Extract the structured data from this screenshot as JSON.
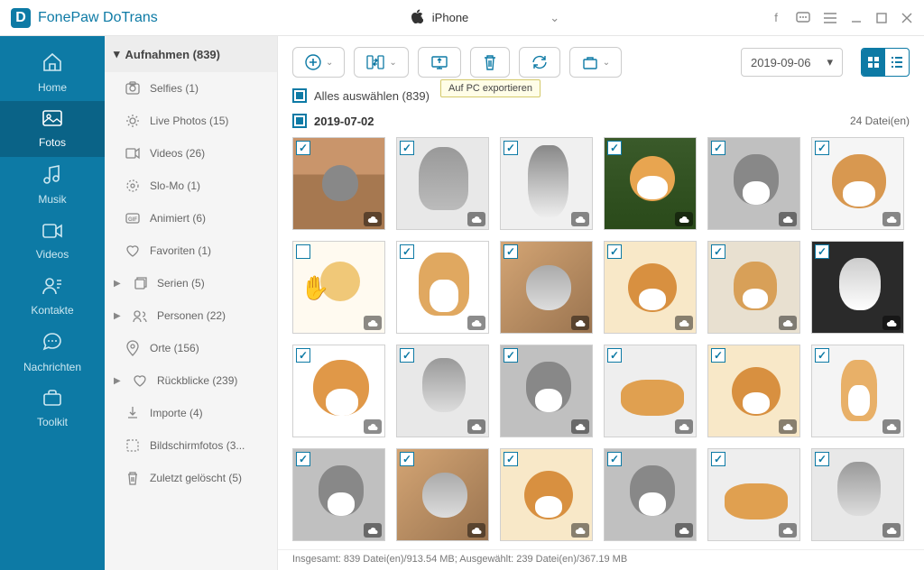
{
  "app_title": "FonePaw DoTrans",
  "device": "iPhone",
  "nav": [
    {
      "label": "Home"
    },
    {
      "label": "Fotos"
    },
    {
      "label": "Musik"
    },
    {
      "label": "Videos"
    },
    {
      "label": "Kontakte"
    },
    {
      "label": "Nachrichten"
    },
    {
      "label": "Toolkit"
    }
  ],
  "subnav": {
    "header": "Aufnahmen (839)",
    "items": [
      {
        "label": "Selfies (1)"
      },
      {
        "label": "Live Photos (15)"
      },
      {
        "label": "Videos (26)"
      },
      {
        "label": "Slo-Mo (1)"
      },
      {
        "label": "Animiert (6)"
      },
      {
        "label": "Favoriten (1)"
      },
      {
        "label": "Serien (5)",
        "arrow": true
      },
      {
        "label": "Personen (22)",
        "arrow": true
      },
      {
        "label": "Orte (156)"
      },
      {
        "label": "Rückblicke (239)",
        "arrow": true
      },
      {
        "label": "Importe (4)"
      },
      {
        "label": "Bildschirmfotos (3..."
      },
      {
        "label": "Zuletzt gelöscht (5)"
      }
    ]
  },
  "tooltip": "Auf PC exportieren",
  "date_picker": "2019-09-06",
  "select_all": "Alles auswählen (839)",
  "date_group": "2019-07-02",
  "file_count": "24 Datei(en)",
  "statusbar": "Insgesamt: 839 Datei(en)/913.54 MB; Ausgewählt: 239 Datei(en)/367.19 MB",
  "thumbs": {
    "row1": [
      {
        "img": "cat1",
        "checked": true
      },
      {
        "img": "cat2",
        "checked": true
      },
      {
        "img": "cat3",
        "checked": true
      },
      {
        "img": "dog1",
        "checked": true
      },
      {
        "img": "catgw",
        "checked": true
      },
      {
        "img": "dog2",
        "checked": true
      }
    ],
    "row2": [
      {
        "img": "hands",
        "checked": false
      },
      {
        "img": "dog3",
        "checked": true
      },
      {
        "img": "cat4",
        "checked": true
      },
      {
        "img": "dog4",
        "checked": true
      },
      {
        "img": "pup",
        "checked": true
      },
      {
        "img": "cat5",
        "checked": true
      }
    ],
    "row3": [
      {
        "img": "shiba",
        "checked": true
      },
      {
        "img": "catlook",
        "checked": true
      },
      {
        "img": "catgw",
        "checked": true
      },
      {
        "img": "shibalie",
        "checked": true
      },
      {
        "img": "dog4",
        "checked": true
      },
      {
        "img": "shibaw",
        "checked": true
      }
    ],
    "row4": [
      {
        "img": "catgw",
        "checked": true
      },
      {
        "img": "cat4",
        "checked": true
      },
      {
        "img": "dog4",
        "checked": true
      },
      {
        "img": "catgw",
        "checked": true
      },
      {
        "img": "shibalie",
        "checked": true
      },
      {
        "img": "catlook",
        "checked": true
      }
    ]
  }
}
